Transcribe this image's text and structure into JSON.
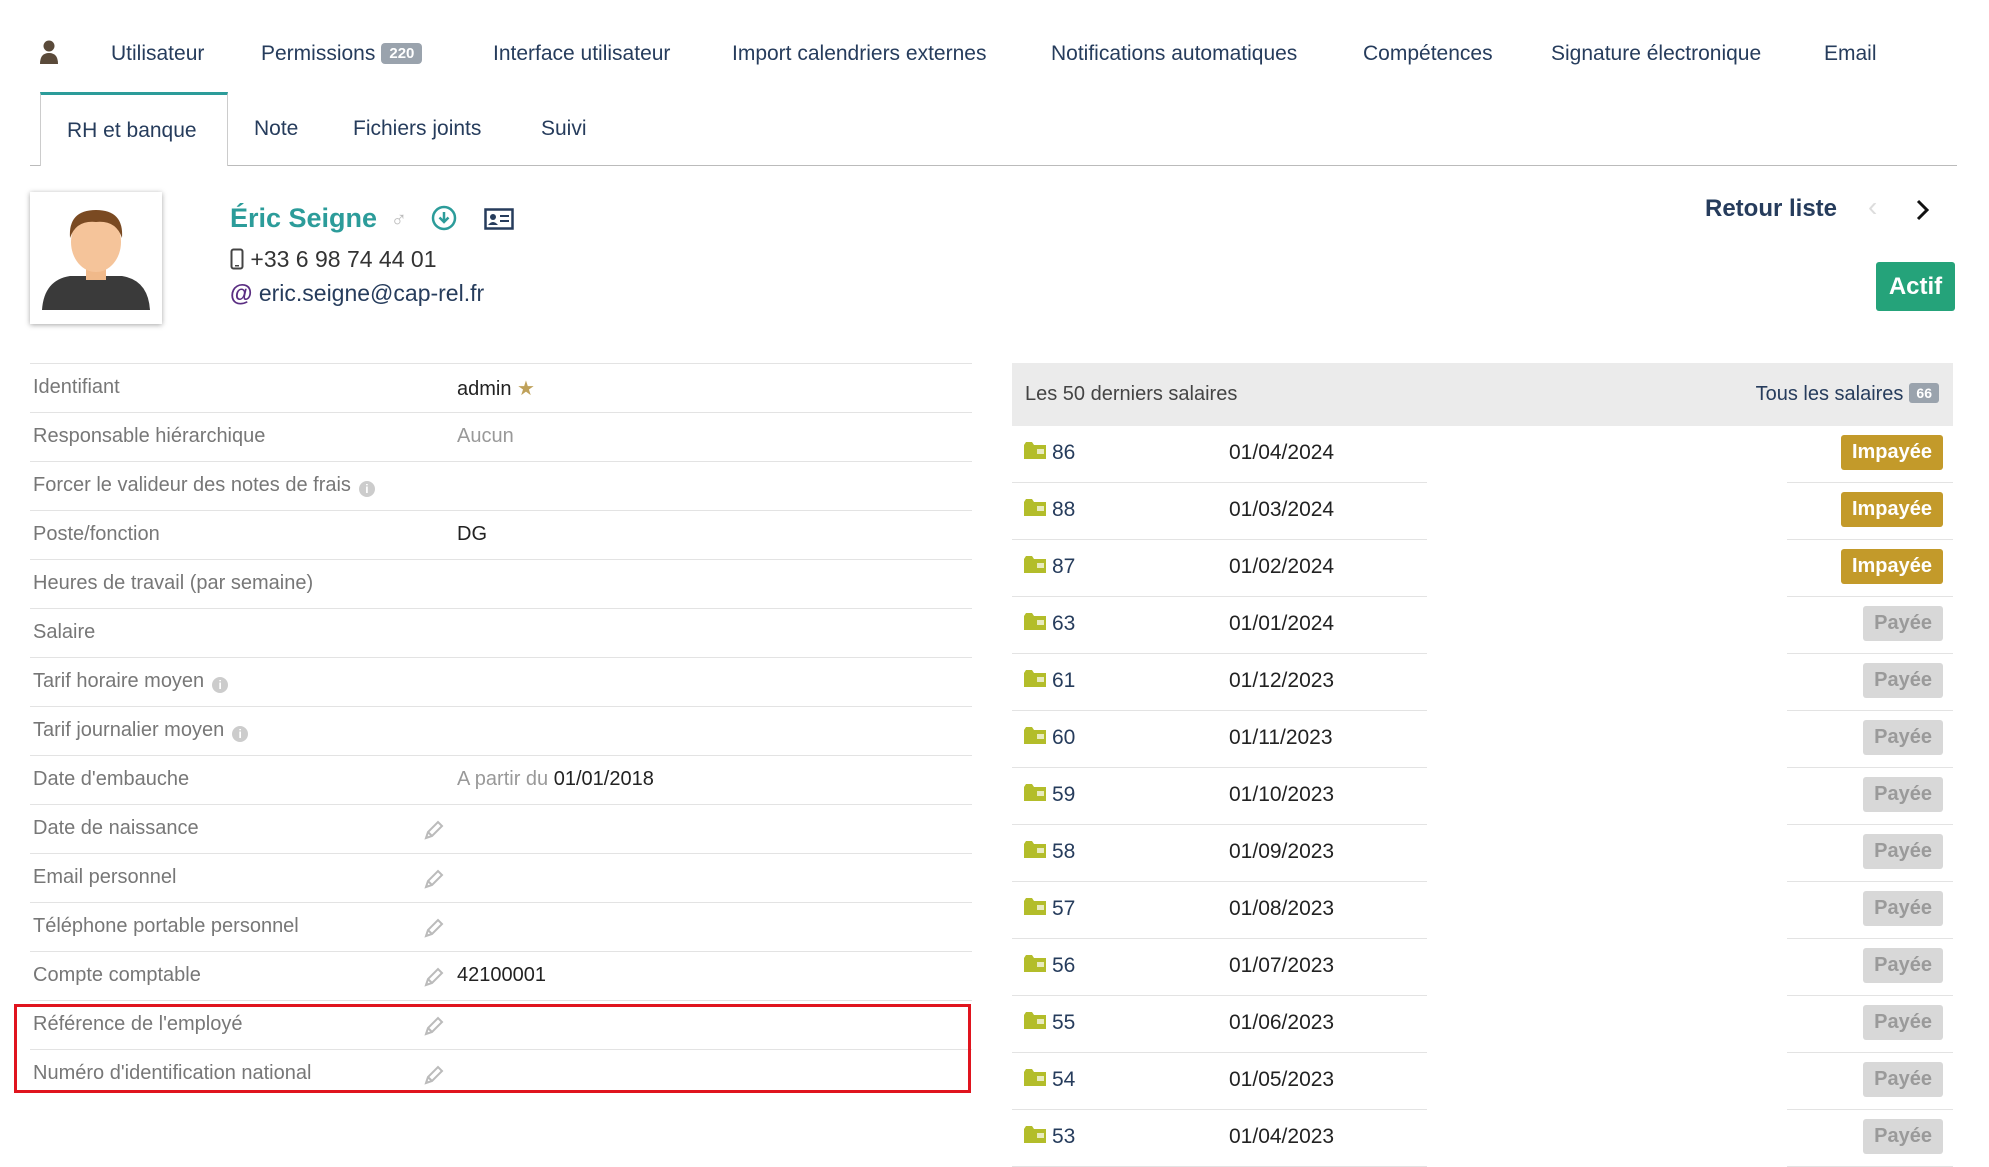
{
  "tabs": {
    "user_icon": "user-icon",
    "primary": [
      {
        "label": "Utilisateur"
      },
      {
        "label": "Permissions",
        "badge": "220"
      },
      {
        "label": "Interface utilisateur"
      },
      {
        "label": "Import calendriers externes"
      },
      {
        "label": "Notifications automatiques"
      },
      {
        "label": "Compétences"
      },
      {
        "label": "Signature électronique"
      },
      {
        "label": "Email"
      }
    ],
    "secondary": [
      {
        "label": "RH et banque",
        "active": true
      },
      {
        "label": "Note"
      },
      {
        "label": "Fichiers joints"
      },
      {
        "label": "Suivi"
      }
    ]
  },
  "profile": {
    "name": "Éric Seigne",
    "phone": "+33 6 98 74 44 01",
    "email": "eric.seigne@cap-rel.fr",
    "back_label": "Retour liste",
    "status": "Actif"
  },
  "fields": [
    {
      "label": "Identifiant",
      "value": "admin"
    },
    {
      "label": "Responsable hiérarchique",
      "value": "Aucun"
    },
    {
      "label": "Forcer le valideur des notes de frais",
      "value": ""
    },
    {
      "label": "Poste/fonction",
      "value": "DG"
    },
    {
      "label": "Heures de travail (par semaine)",
      "value": ""
    },
    {
      "label": "Salaire",
      "value": ""
    },
    {
      "label": "Tarif horaire moyen",
      "value": ""
    },
    {
      "label": "Tarif journalier moyen",
      "value": ""
    },
    {
      "label": "Date d'embauche",
      "value_prefix": "A partir du",
      "value": "01/01/2018"
    },
    {
      "label": "Date de naissance",
      "value": ""
    },
    {
      "label": "Email personnel",
      "value": ""
    },
    {
      "label": "Téléphone portable personnel",
      "value": ""
    },
    {
      "label": "Compte comptable",
      "value": "42100001"
    },
    {
      "label": "Référence de l'employé",
      "value": ""
    },
    {
      "label": "Numéro d'identification national",
      "value": ""
    }
  ],
  "salaries": {
    "title": "Les 50 derniers salaires",
    "all_label": "Tous les salaires",
    "all_count": "66",
    "rows": [
      {
        "num": "86",
        "date": "01/04/2024",
        "status": "Impayée"
      },
      {
        "num": "88",
        "date": "01/03/2024",
        "status": "Impayée"
      },
      {
        "num": "87",
        "date": "01/02/2024",
        "status": "Impayée"
      },
      {
        "num": "63",
        "date": "01/01/2024",
        "status": "Payée"
      },
      {
        "num": "61",
        "date": "01/12/2023",
        "status": "Payée"
      },
      {
        "num": "60",
        "date": "01/11/2023",
        "status": "Payée"
      },
      {
        "num": "59",
        "date": "01/10/2023",
        "status": "Payée"
      },
      {
        "num": "58",
        "date": "01/09/2023",
        "status": "Payée"
      },
      {
        "num": "57",
        "date": "01/08/2023",
        "status": "Payée"
      },
      {
        "num": "56",
        "date": "01/07/2023",
        "status": "Payée"
      },
      {
        "num": "55",
        "date": "01/06/2023",
        "status": "Payée"
      },
      {
        "num": "54",
        "date": "01/05/2023",
        "status": "Payée"
      },
      {
        "num": "53",
        "date": "01/04/2023",
        "status": "Payée"
      }
    ]
  },
  "colors": {
    "accent": "#2c9c9a",
    "active": "#25a37a",
    "unpaid": "#c39a2a",
    "highlight": "#e0141e",
    "link": "#263c5c"
  }
}
